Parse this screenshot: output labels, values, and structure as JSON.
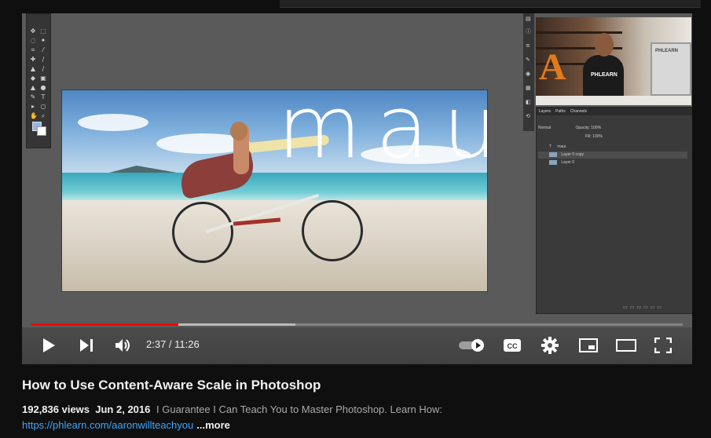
{
  "video": {
    "title": "How to Use Content-Aware Scale in Photoshop",
    "overlay_text": "maui",
    "shirt_text": "PHLEARN",
    "monitor_text": "PHLEARN",
    "progress": {
      "played_fraction": 0.225,
      "buffered_fraction": 0.405
    },
    "time": "2:37 / 11:26"
  },
  "photoshop": {
    "layers_tabs": [
      "Layers",
      "Paths",
      "Channels"
    ],
    "blend_mode": "Normal",
    "opacity": "Opacity: 100%",
    "fill": "Fill: 100%",
    "layers": [
      "maui",
      "Layer 0 copy",
      "Layer 0"
    ]
  },
  "controls": {
    "play": "play-icon",
    "next": "next-icon",
    "volume": "volume-icon",
    "autoplay": "autoplay-toggle",
    "cc": "CC",
    "settings": "gear-icon",
    "miniplayer": "miniplayer-icon",
    "theater": "theater-icon",
    "fullscreen": "fullscreen-icon"
  },
  "info": {
    "views": "192,836 views",
    "date": "Jun 2, 2016",
    "description": "I Guarantee I Can Teach You to Master Photoshop. Learn How:",
    "link": "https://phlearn.com/aaronwillteachyou",
    "more": "...more"
  },
  "colors": {
    "accent_red": "#ff0000",
    "link": "#3ea6ff",
    "background": "#0f0f0f"
  }
}
